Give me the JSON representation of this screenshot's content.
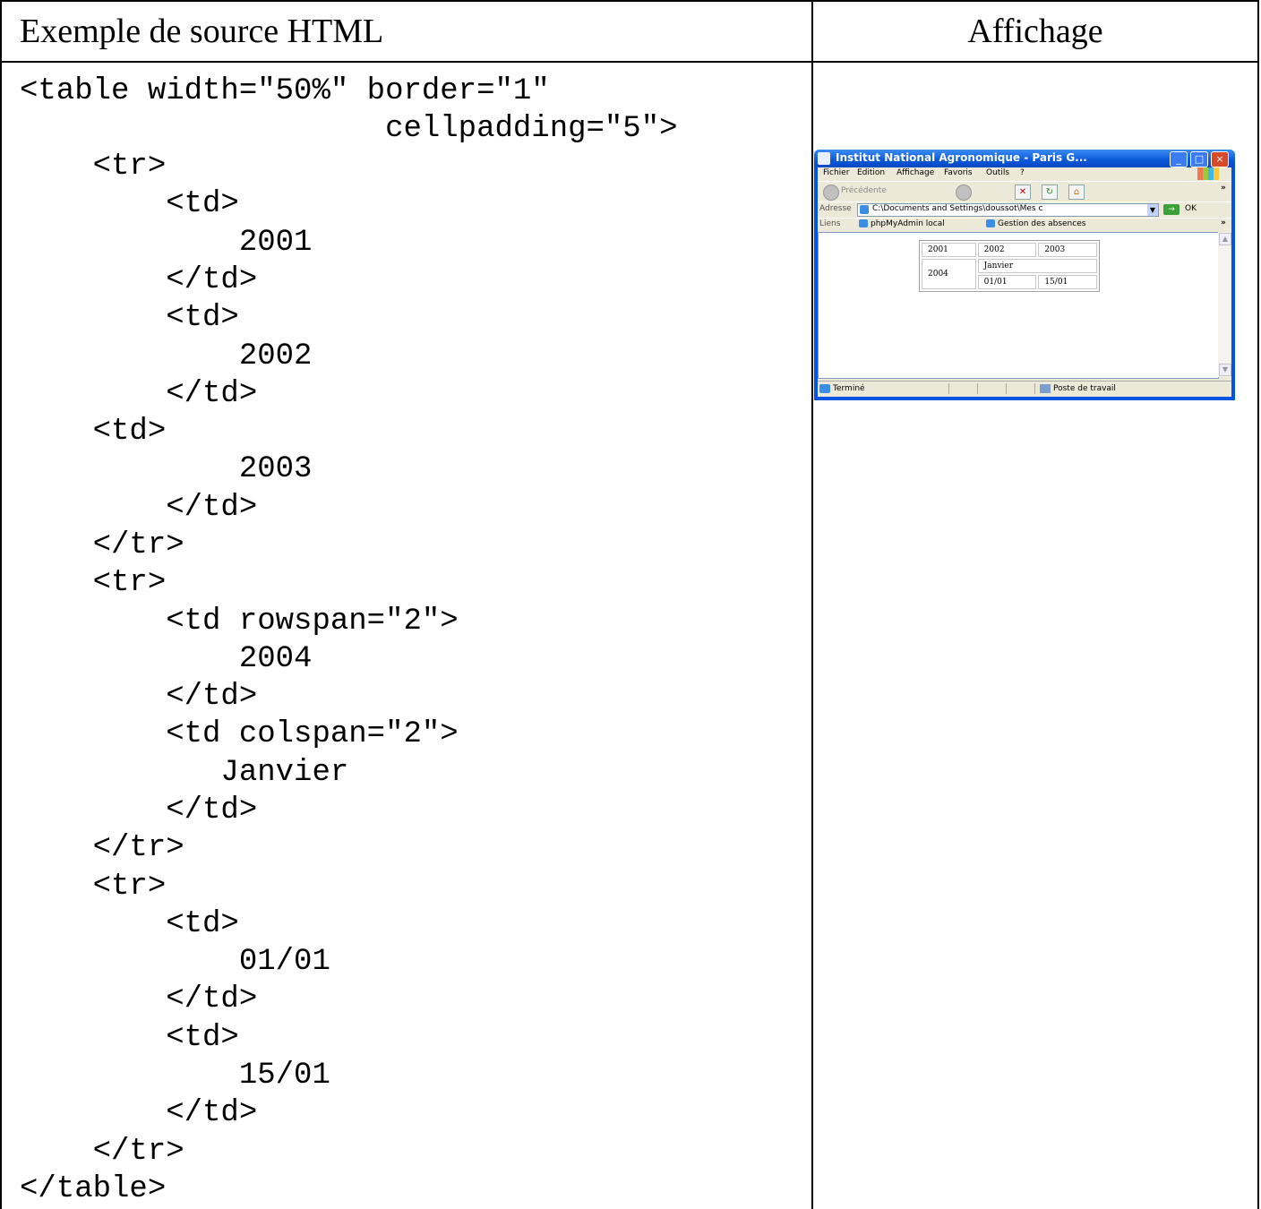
{
  "header": {
    "left": "Exemple de source HTML",
    "right": "Affichage"
  },
  "code_lines": [
    "<table width=\"50%\" border=\"1\"",
    "                    cellpadding=\"5\">",
    "    <tr>",
    "        <td>",
    "            2001",
    "        </td>",
    "        <td>",
    "            2002",
    "        </td>",
    "    <td>",
    "            2003",
    "        </td>",
    "    </tr>",
    "    <tr>",
    "        <td rowspan=\"2\">",
    "            2004",
    "        </td>",
    "        <td colspan=\"2\">",
    "           Janvier",
    "        </td>",
    "    </tr>",
    "    <tr>",
    "        <td>",
    "            01/01",
    "        </td>",
    "        <td>",
    "            15/01",
    "        </td>",
    "    </tr>",
    "</table>"
  ],
  "browser": {
    "title": "Institut National Agronomique - Paris G...",
    "menu": [
      "Fichier",
      "Edition",
      "Affichage",
      "Favoris",
      "Outils",
      "?"
    ],
    "toolbar": {
      "back_label": "Précédente"
    },
    "address": {
      "label": "Adresse",
      "value": "C:\\Documents and Settings\\doussot\\Mes c",
      "go_label": "OK"
    },
    "links": {
      "label": "Liens",
      "items": [
        "phpMyAdmin local",
        "Gestion des absences"
      ]
    },
    "table": {
      "row1": [
        "2001",
        "2002",
        "2003"
      ],
      "rowspan_cell": "2004",
      "colspan_cell": "Janvier",
      "row3": [
        "01/01",
        "15/01"
      ]
    },
    "status": {
      "left": "Terminé",
      "right": "Poste de travail"
    }
  },
  "colors": {
    "titlebar": "#0054e3",
    "chrome": "#ece9d8",
    "border": "#000000"
  }
}
